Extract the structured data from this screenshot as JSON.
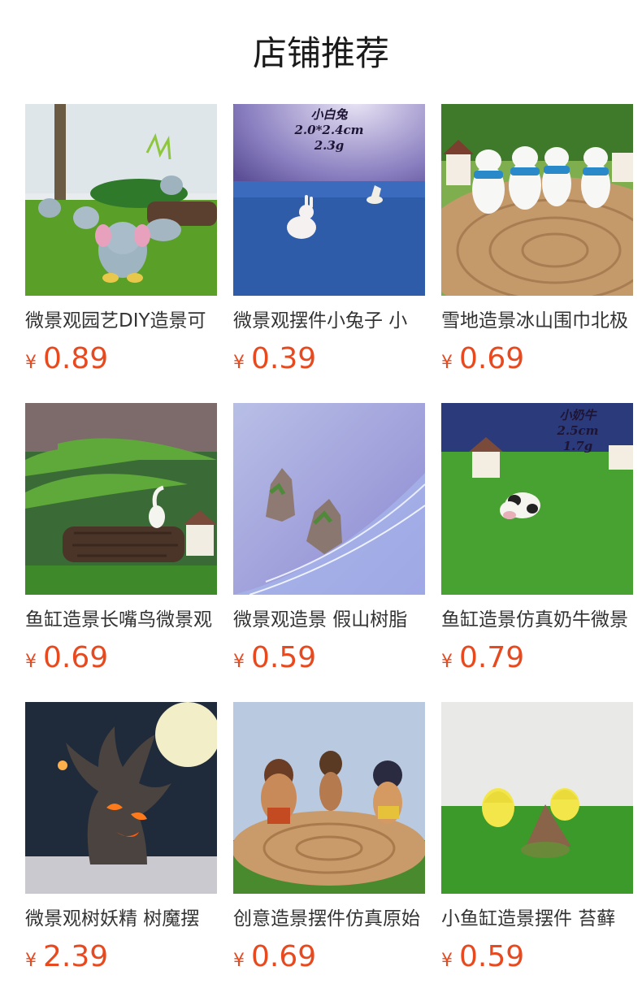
{
  "section_title": "店铺推荐",
  "currency": "¥",
  "products": [
    {
      "name": "微景观园艺DIY造景可",
      "price": "0.89",
      "image": "elephant-figurines"
    },
    {
      "name": "微景观摆件小兔子 小",
      "price": "0.39",
      "image": "white-rabbit",
      "overlay": [
        "小白兔",
        "2.0*2.4cm",
        "2.3g"
      ]
    },
    {
      "name": "雪地造景冰山围巾北极",
      "price": "0.69",
      "image": "polar-bears-scarves"
    },
    {
      "name": "鱼缸造景长嘴鸟微景观",
      "price": "0.69",
      "image": "stork-on-log"
    },
    {
      "name": "微景观造景 假山树脂",
      "price": "0.59",
      "image": "rockery-stones"
    },
    {
      "name": "鱼缸造景仿真奶牛微景",
      "price": "0.79",
      "image": "dairy-cow",
      "overlay": [
        "小奶牛",
        "2.5cm",
        "1.7g"
      ]
    },
    {
      "name": "微景观树妖精 树魔摆",
      "price": "2.39",
      "image": "tree-monster"
    },
    {
      "name": "创意造景摆件仿真原始",
      "price": "0.69",
      "image": "caveman-figures"
    },
    {
      "name": "小鱼缸造景摆件 苔藓",
      "price": "0.59",
      "image": "moss-huts"
    }
  ]
}
